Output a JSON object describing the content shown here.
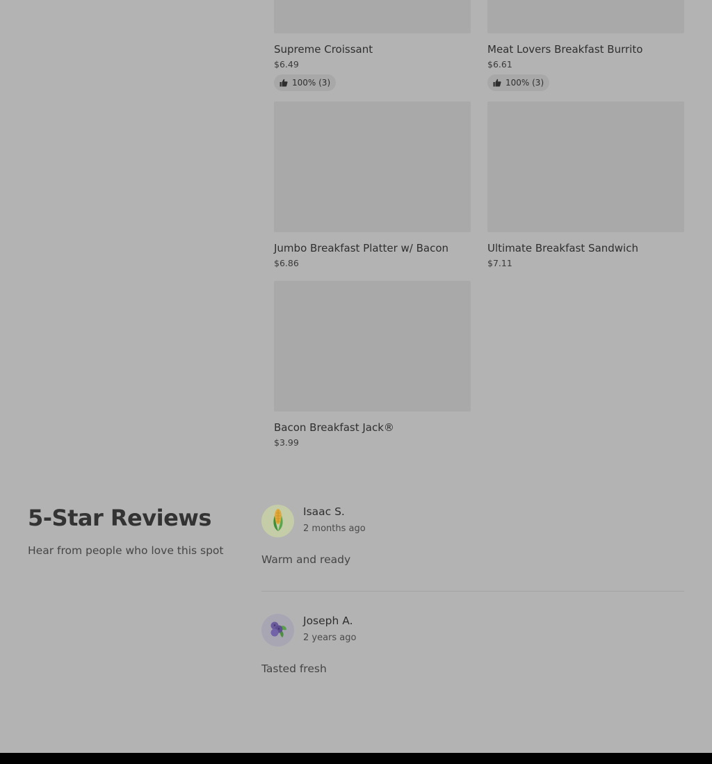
{
  "menu": {
    "items": [
      {
        "name": "Supreme Croissant",
        "price": "$6.49",
        "rating": "100% (3)"
      },
      {
        "name": "Meat Lovers Breakfast Burrito",
        "price": "$6.61",
        "rating": "100% (3)"
      },
      {
        "name": "Jumbo Breakfast Platter w/ Bacon",
        "price": "$6.86"
      },
      {
        "name": "Ultimate Breakfast Sandwich",
        "price": "$7.11"
      },
      {
        "name": "Bacon Breakfast Jack®",
        "price": "$3.99"
      }
    ],
    "rating_icon": "thumbs-up-icon"
  },
  "reviews": {
    "title": "5-Star Reviews",
    "subtitle": "Hear from people who love this spot",
    "items": [
      {
        "author": "Isaac S.",
        "date": "2 months ago",
        "text": "Warm and ready",
        "avatar_icon": "corn-icon",
        "avatar_bg": "#c4cda8"
      },
      {
        "author": "Joseph A.",
        "date": "2 years ago",
        "text": "Tasted fresh",
        "avatar_icon": "blueberry-icon",
        "avatar_bg": "#a9a6b4"
      }
    ]
  },
  "colors": {
    "overlay_background": "#b3b3b3",
    "image_placeholder": "#a9a9a9",
    "footer": "#000000"
  }
}
